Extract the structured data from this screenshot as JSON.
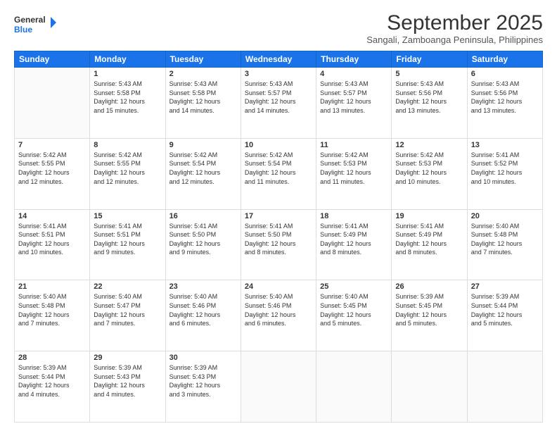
{
  "logo": {
    "line1": "General",
    "line2": "Blue"
  },
  "header": {
    "month": "September 2025",
    "location": "Sangali, Zamboanga Peninsula, Philippines"
  },
  "weekdays": [
    "Sunday",
    "Monday",
    "Tuesday",
    "Wednesday",
    "Thursday",
    "Friday",
    "Saturday"
  ],
  "weeks": [
    [
      {
        "day": "",
        "info": ""
      },
      {
        "day": "1",
        "info": "Sunrise: 5:43 AM\nSunset: 5:58 PM\nDaylight: 12 hours\nand 15 minutes."
      },
      {
        "day": "2",
        "info": "Sunrise: 5:43 AM\nSunset: 5:58 PM\nDaylight: 12 hours\nand 14 minutes."
      },
      {
        "day": "3",
        "info": "Sunrise: 5:43 AM\nSunset: 5:57 PM\nDaylight: 12 hours\nand 14 minutes."
      },
      {
        "day": "4",
        "info": "Sunrise: 5:43 AM\nSunset: 5:57 PM\nDaylight: 12 hours\nand 13 minutes."
      },
      {
        "day": "5",
        "info": "Sunrise: 5:43 AM\nSunset: 5:56 PM\nDaylight: 12 hours\nand 13 minutes."
      },
      {
        "day": "6",
        "info": "Sunrise: 5:43 AM\nSunset: 5:56 PM\nDaylight: 12 hours\nand 13 minutes."
      }
    ],
    [
      {
        "day": "7",
        "info": "Sunrise: 5:42 AM\nSunset: 5:55 PM\nDaylight: 12 hours\nand 12 minutes."
      },
      {
        "day": "8",
        "info": "Sunrise: 5:42 AM\nSunset: 5:55 PM\nDaylight: 12 hours\nand 12 minutes."
      },
      {
        "day": "9",
        "info": "Sunrise: 5:42 AM\nSunset: 5:54 PM\nDaylight: 12 hours\nand 12 minutes."
      },
      {
        "day": "10",
        "info": "Sunrise: 5:42 AM\nSunset: 5:54 PM\nDaylight: 12 hours\nand 11 minutes."
      },
      {
        "day": "11",
        "info": "Sunrise: 5:42 AM\nSunset: 5:53 PM\nDaylight: 12 hours\nand 11 minutes."
      },
      {
        "day": "12",
        "info": "Sunrise: 5:42 AM\nSunset: 5:53 PM\nDaylight: 12 hours\nand 10 minutes."
      },
      {
        "day": "13",
        "info": "Sunrise: 5:41 AM\nSunset: 5:52 PM\nDaylight: 12 hours\nand 10 minutes."
      }
    ],
    [
      {
        "day": "14",
        "info": "Sunrise: 5:41 AM\nSunset: 5:51 PM\nDaylight: 12 hours\nand 10 minutes."
      },
      {
        "day": "15",
        "info": "Sunrise: 5:41 AM\nSunset: 5:51 PM\nDaylight: 12 hours\nand 9 minutes."
      },
      {
        "day": "16",
        "info": "Sunrise: 5:41 AM\nSunset: 5:50 PM\nDaylight: 12 hours\nand 9 minutes."
      },
      {
        "day": "17",
        "info": "Sunrise: 5:41 AM\nSunset: 5:50 PM\nDaylight: 12 hours\nand 8 minutes."
      },
      {
        "day": "18",
        "info": "Sunrise: 5:41 AM\nSunset: 5:49 PM\nDaylight: 12 hours\nand 8 minutes."
      },
      {
        "day": "19",
        "info": "Sunrise: 5:41 AM\nSunset: 5:49 PM\nDaylight: 12 hours\nand 8 minutes."
      },
      {
        "day": "20",
        "info": "Sunrise: 5:40 AM\nSunset: 5:48 PM\nDaylight: 12 hours\nand 7 minutes."
      }
    ],
    [
      {
        "day": "21",
        "info": "Sunrise: 5:40 AM\nSunset: 5:48 PM\nDaylight: 12 hours\nand 7 minutes."
      },
      {
        "day": "22",
        "info": "Sunrise: 5:40 AM\nSunset: 5:47 PM\nDaylight: 12 hours\nand 7 minutes."
      },
      {
        "day": "23",
        "info": "Sunrise: 5:40 AM\nSunset: 5:46 PM\nDaylight: 12 hours\nand 6 minutes."
      },
      {
        "day": "24",
        "info": "Sunrise: 5:40 AM\nSunset: 5:46 PM\nDaylight: 12 hours\nand 6 minutes."
      },
      {
        "day": "25",
        "info": "Sunrise: 5:40 AM\nSunset: 5:45 PM\nDaylight: 12 hours\nand 5 minutes."
      },
      {
        "day": "26",
        "info": "Sunrise: 5:39 AM\nSunset: 5:45 PM\nDaylight: 12 hours\nand 5 minutes."
      },
      {
        "day": "27",
        "info": "Sunrise: 5:39 AM\nSunset: 5:44 PM\nDaylight: 12 hours\nand 5 minutes."
      }
    ],
    [
      {
        "day": "28",
        "info": "Sunrise: 5:39 AM\nSunset: 5:44 PM\nDaylight: 12 hours\nand 4 minutes."
      },
      {
        "day": "29",
        "info": "Sunrise: 5:39 AM\nSunset: 5:43 PM\nDaylight: 12 hours\nand 4 minutes."
      },
      {
        "day": "30",
        "info": "Sunrise: 5:39 AM\nSunset: 5:43 PM\nDaylight: 12 hours\nand 3 minutes."
      },
      {
        "day": "",
        "info": ""
      },
      {
        "day": "",
        "info": ""
      },
      {
        "day": "",
        "info": ""
      },
      {
        "day": "",
        "info": ""
      }
    ]
  ]
}
